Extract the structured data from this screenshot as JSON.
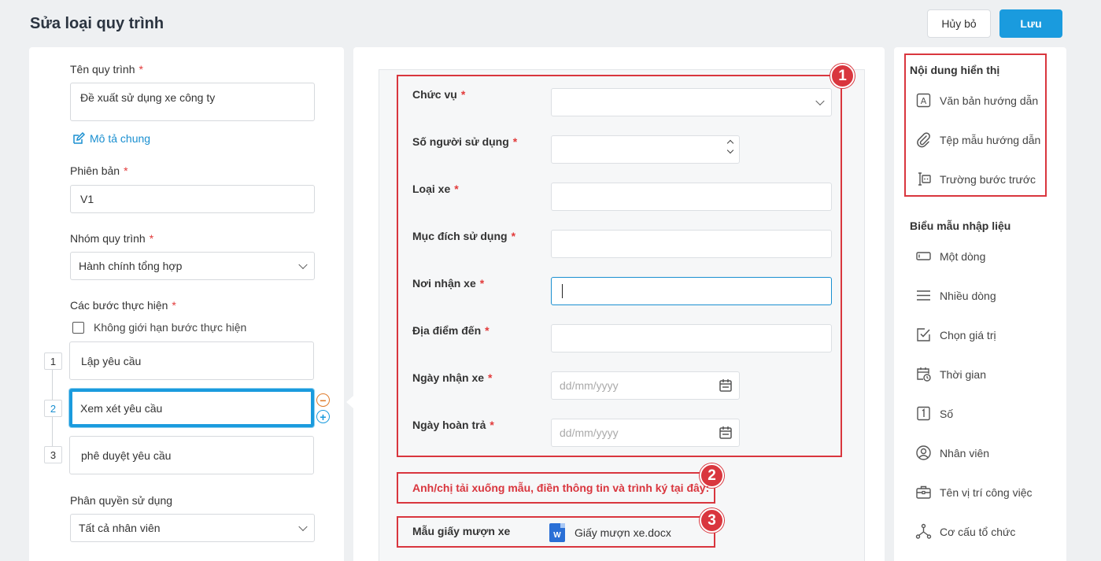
{
  "header": {
    "title": "Sửa loại quy trình",
    "cancel_label": "Hủy bỏ",
    "save_label": "Lưu"
  },
  "left": {
    "name_label": "Tên quy trình",
    "name_value": "Đề xuất sử dụng xe công ty",
    "description_link": "Mô tả chung",
    "version_label": "Phiên bản",
    "version_value": "V1",
    "group_label": "Nhóm quy trình",
    "group_value": "Hành chính tổng hợp",
    "steps_label": "Các bước thực hiện",
    "unlimited_label": "Không giới hạn bước thực hiện",
    "steps": [
      {
        "num": "1",
        "name": "Lập yêu cầu"
      },
      {
        "num": "2",
        "name": "Xem xét yêu cầu"
      },
      {
        "num": "3",
        "name": "phê duyệt yêu cầu"
      }
    ],
    "permission_label": "Phân quyền sử dụng",
    "permission_value": "Tất cả nhân viên",
    "required_mark": "*"
  },
  "form": {
    "badges": [
      "1",
      "2",
      "3"
    ],
    "fields": [
      {
        "label": "Chức vụ",
        "placeholder": ""
      },
      {
        "label": "Số người sử dụng",
        "placeholder": ""
      },
      {
        "label": "Loại xe",
        "placeholder": ""
      },
      {
        "label": "Mục đích sử dụng",
        "placeholder": ""
      },
      {
        "label": "Nơi nhận xe",
        "placeholder": ""
      },
      {
        "label": "Địa điểm đến",
        "placeholder": ""
      },
      {
        "label": "Ngày nhận xe",
        "placeholder": "dd/mm/yyyy"
      },
      {
        "label": "Ngày hoàn trả",
        "placeholder": "dd/mm/yyyy"
      }
    ],
    "instruction_text": "Anh/chị tải xuống mẫu, điền thông tin và trình ký tại đây:",
    "file_label": "Mẫu giấy mượn xe",
    "file_name": "Giấy mượn xe.docx",
    "file_icon_letter": "W"
  },
  "right": {
    "display_title": "Nội dung hiển thị",
    "display_items": [
      {
        "label": "Văn bản hướng dẫn",
        "icon": "text-icon"
      },
      {
        "label": "Tệp mẫu hướng dẫn",
        "icon": "paperclip-icon"
      },
      {
        "label": "Trường bước trước",
        "icon": "field-icon"
      }
    ],
    "input_title": "Biểu mẫu nhập liệu",
    "input_items": [
      {
        "label": "Một dòng",
        "icon": "single-line-icon"
      },
      {
        "label": "Nhiều dòng",
        "icon": "multi-line-icon"
      },
      {
        "label": "Chọn giá trị",
        "icon": "checkbox-icon"
      },
      {
        "label": "Thời gian",
        "icon": "calendar-clock-icon"
      },
      {
        "label": "Số",
        "icon": "number-icon"
      },
      {
        "label": "Nhân viên",
        "icon": "user-icon"
      },
      {
        "label": "Tên vị trí công việc",
        "icon": "briefcase-icon"
      },
      {
        "label": "Cơ cấu tổ chức",
        "icon": "org-chart-icon"
      }
    ]
  },
  "colors": {
    "accent": "#1a9bde",
    "highlight_red": "#d9363e"
  }
}
